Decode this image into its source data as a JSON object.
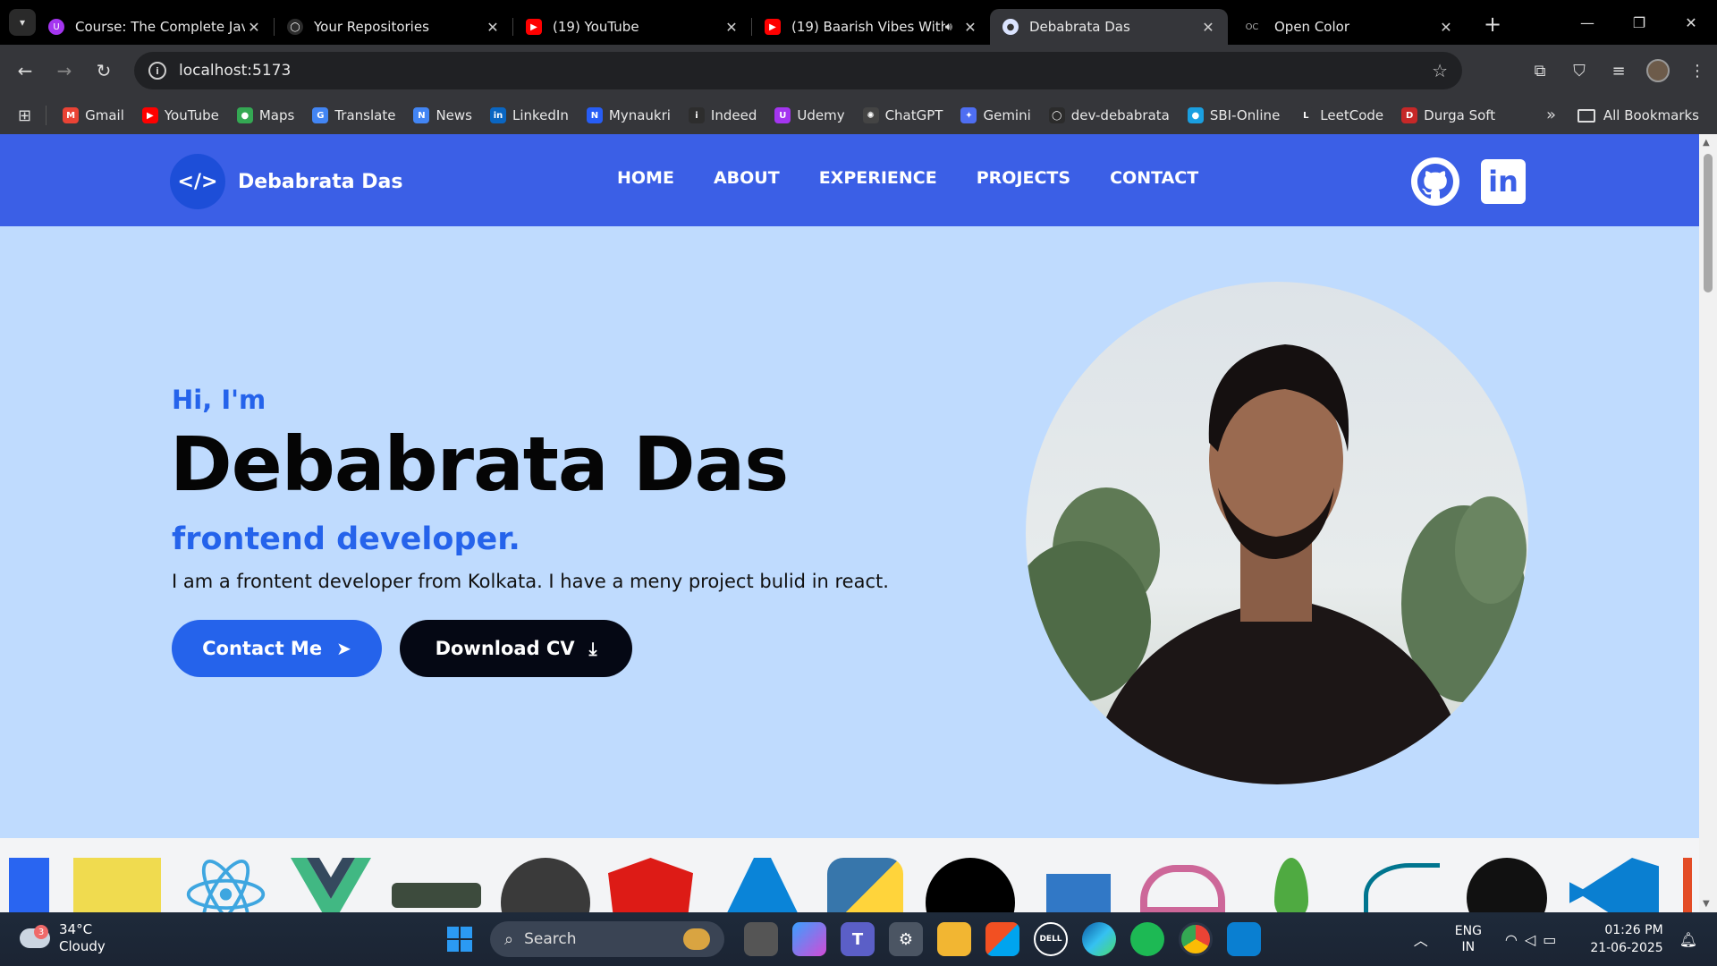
{
  "browser": {
    "tabs": [
      {
        "title": "Course: The Complete Java",
        "favicon_color": "#a435f0",
        "favicon": "U"
      },
      {
        "title": "Your Repositories",
        "favicon_color": "#2b2b2b",
        "favicon": "◯"
      },
      {
        "title": "(19) YouTube",
        "favicon_color": "#ff0000",
        "favicon": "▶"
      },
      {
        "title": "(19) Baarish Vibes With",
        "favicon_color": "#ff0000",
        "favicon": "▶"
      },
      {
        "title": "Debabrata Das",
        "favicon_color": "#dbe4ff",
        "favicon": "●"
      },
      {
        "title": "Open Color",
        "favicon_color": "#35363a",
        "favicon": "OC"
      }
    ],
    "address": {
      "url": "localhost:5173"
    },
    "bookmarks": [
      {
        "label": "Gmail",
        "icon": "gmail-icon",
        "color": "#ea4335",
        "glyph": "M"
      },
      {
        "label": "YouTube",
        "icon": "youtube-icon",
        "color": "#ff0000",
        "glyph": "▶"
      },
      {
        "label": "Maps",
        "icon": "maps-icon",
        "color": "#34a853",
        "glyph": "●"
      },
      {
        "label": "Translate",
        "icon": "translate-icon",
        "color": "#4285f4",
        "glyph": "G"
      },
      {
        "label": "News",
        "icon": "news-icon",
        "color": "#4285f4",
        "glyph": "N"
      },
      {
        "label": "LinkedIn",
        "icon": "linkedin-icon",
        "color": "#0a66c2",
        "glyph": "in"
      },
      {
        "label": "Mynaukri",
        "icon": "naukri-icon",
        "color": "#275df5",
        "glyph": "N"
      },
      {
        "label": "Indeed",
        "icon": "indeed-icon",
        "color": "#2d2d2d",
        "glyph": "i"
      },
      {
        "label": "Udemy",
        "icon": "udemy-icon",
        "color": "#a435f0",
        "glyph": "U"
      },
      {
        "label": "ChatGPT",
        "icon": "chatgpt-icon",
        "color": "#444",
        "glyph": "✺"
      },
      {
        "label": "Gemini",
        "icon": "gemini-icon",
        "color": "#4e6ef2",
        "glyph": "✦"
      },
      {
        "label": "dev-debabrata",
        "icon": "github-icon",
        "color": "#2b2b2b",
        "glyph": "◯"
      },
      {
        "label": "SBI-Online",
        "icon": "sbi-icon",
        "color": "#1a9fe0",
        "glyph": "●"
      },
      {
        "label": "LeetCode",
        "icon": "leetcode-icon",
        "color": "#35363a",
        "glyph": "L"
      },
      {
        "label": "Durga Soft",
        "icon": "durgasoft-icon",
        "color": "#c62828",
        "glyph": "D"
      }
    ],
    "all_bookmarks_label": "All Bookmarks"
  },
  "site": {
    "brand": {
      "logo_text": "</>",
      "name": "Debabrata Das"
    },
    "nav": [
      "HOME",
      "ABOUT",
      "EXPERIENCE",
      "PROJECTS",
      "CONTACT"
    ],
    "social": {
      "linkedin_text": "in"
    },
    "hero": {
      "greeting": "Hi, I'm",
      "name": "Debabrata Das",
      "role": "frontend developer.",
      "bio": "I am a frontent developer from Kolkata. I have a meny project bulid in react.",
      "contact_button": "Contact Me",
      "cv_button": "Download CV"
    },
    "tech_icons": [
      "css3-icon",
      "javascript-icon",
      "react-icon",
      "vue-icon",
      "nodejs-icon",
      "express-icon",
      "angular-icon",
      "azure-icon",
      "python-icon",
      "nextjs-icon",
      "typescript-icon",
      "sass-icon",
      "mongodb-icon",
      "mysql-icon",
      "github-icon",
      "vscode-icon"
    ]
  },
  "taskbar": {
    "weather": {
      "temp": "34°C",
      "condition": "Cloudy",
      "badge": "3"
    },
    "search_label": "Search",
    "language": {
      "line1": "ENG",
      "line2": "IN"
    },
    "clock": {
      "time": "01:26 PM",
      "date": "21-06-2025"
    }
  }
}
